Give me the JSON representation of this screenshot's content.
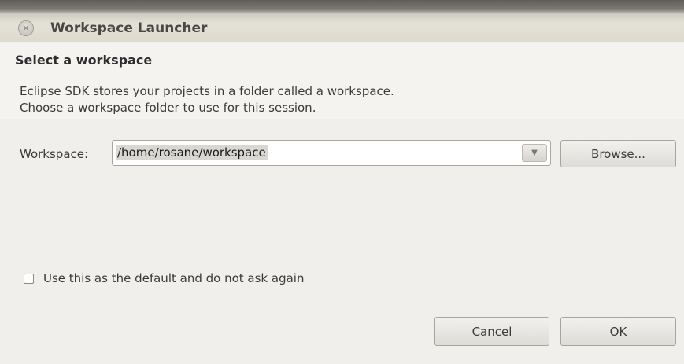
{
  "window": {
    "title": "Workspace Launcher",
    "close_icon": "close-icon"
  },
  "header": {
    "title": "Select a workspace",
    "description_line1": "Eclipse SDK stores your projects in a folder called a workspace.",
    "description_line2": "Choose a workspace folder to use for this session."
  },
  "workspace": {
    "label": "Workspace:",
    "value": "/home/rosane/workspace",
    "dropdown_icon": "chevron-down-icon",
    "browse_label": "Browse..."
  },
  "options": {
    "default_checkbox_label": "Use this as the default and do not ask again",
    "default_checked": false
  },
  "footer": {
    "cancel_label": "Cancel",
    "ok_label": "OK"
  }
}
